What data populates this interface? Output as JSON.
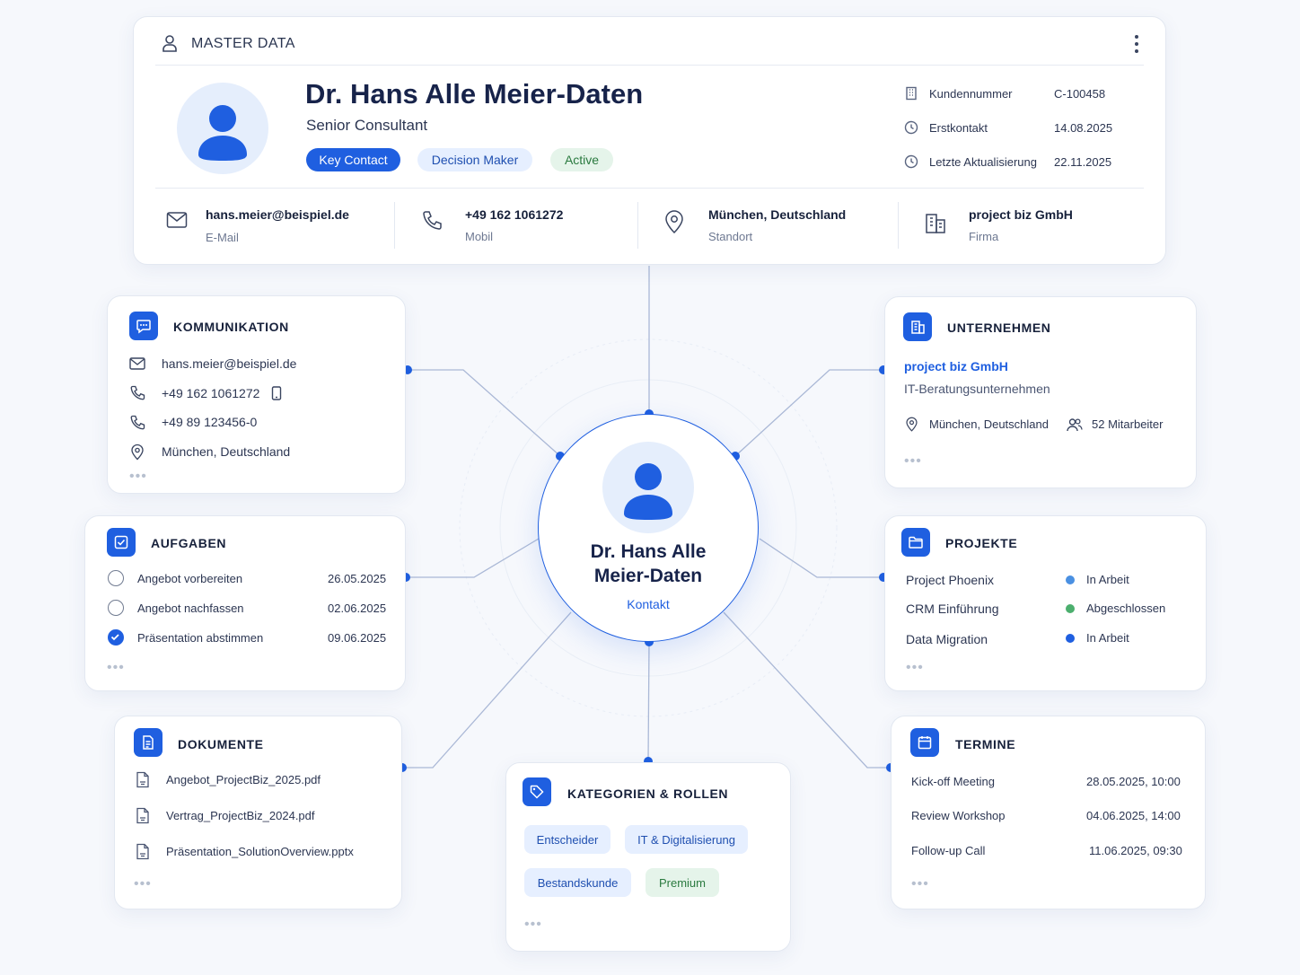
{
  "header": {
    "section_title": "MASTER DATA",
    "name": "Dr. Hans Alle Meier-Daten",
    "job_title": "Senior Consultant",
    "tags": [
      "Key Contact",
      "Decision Maker",
      "Active"
    ],
    "meta": [
      {
        "label": "Kundennummer",
        "value": "C-100458",
        "icon": "building-icon"
      },
      {
        "label": "Erstkontakt",
        "value": "14.08.2025",
        "icon": "clock-icon"
      },
      {
        "label": "Letzte Aktualisierung",
        "value": "22.11.2025",
        "icon": "clock-icon"
      }
    ],
    "contacts": [
      {
        "value": "hans.meier@beispiel.de",
        "label": "E-Mail",
        "icon": "mail-icon"
      },
      {
        "value": "+49 162 1061272",
        "label": "Mobil",
        "icon": "phone-icon"
      },
      {
        "value": "München, Deutschland",
        "label": "Standort",
        "icon": "location-icon"
      },
      {
        "value": "project biz GmbH",
        "label": "Firma",
        "icon": "building-icon"
      }
    ]
  },
  "center": {
    "name_line1": "Dr. Hans Alle",
    "name_line2": "Meier-Daten",
    "role": "Kontakt"
  },
  "kommunikation": {
    "title": "KOMMUNIKATION",
    "items": [
      "hans.meier@beispiel.de",
      "+49 162 1061272",
      "+49 89 123456-0",
      "München, Deutschland"
    ],
    "more": "•••"
  },
  "unternehmen": {
    "title": "UNTERNEHMEN",
    "company": "project biz GmbH",
    "description": "IT-Beratungsunternehmen",
    "location": "München, Deutschland",
    "employees": "52 Mitarbeiter",
    "more": "•••"
  },
  "aufgaben": {
    "title": "AUFGABEN",
    "tasks": [
      {
        "label": "Angebot vorbereiten",
        "date": "26.05.2025",
        "done": false
      },
      {
        "label": "Angebot nachfassen",
        "date": "02.06.2025",
        "done": false
      },
      {
        "label": "Präsentation abstimmen",
        "date": "09.06.2025",
        "done": true
      }
    ],
    "more": "•••"
  },
  "projekte": {
    "title": "PROJEKTE",
    "projects": [
      {
        "name": "Project Phoenix",
        "status": "In Arbeit",
        "color": "#4a90e2"
      },
      {
        "name": "CRM Einführung",
        "status": "Abgeschlossen",
        "color": "#4caf6e"
      },
      {
        "name": "Data Migration",
        "status": "In Arbeit",
        "color": "#1f5fe0"
      }
    ],
    "more": "•••"
  },
  "dokumente": {
    "title": "DOKUMENTE",
    "files": [
      "Angebot_ProjectBiz_2025.pdf",
      "Vertrag_ProjectBiz_2024.pdf",
      "Präsentation_SolutionOverview.pptx"
    ],
    "more": "•••"
  },
  "kategorien": {
    "title": "KATEGORIEN & ROLLEN",
    "chips": [
      "Entscheider",
      "IT & Digitalisierung",
      "Bestandskunde",
      "Premium"
    ],
    "more": "•••"
  },
  "termine": {
    "title": "TERMINE",
    "events": [
      {
        "name": "Kick-off Meeting",
        "datetime": "28.05.2025, 10:00"
      },
      {
        "name": "Review Workshop",
        "datetime": "04.06.2025, 14:00"
      },
      {
        "name": "Follow-up Call",
        "datetime": "11.06.2025, 09:30"
      }
    ],
    "more": "•••"
  },
  "colors": {
    "accent": "#1f5fe0",
    "text": "#1a2340",
    "success": "#4caf6e"
  }
}
